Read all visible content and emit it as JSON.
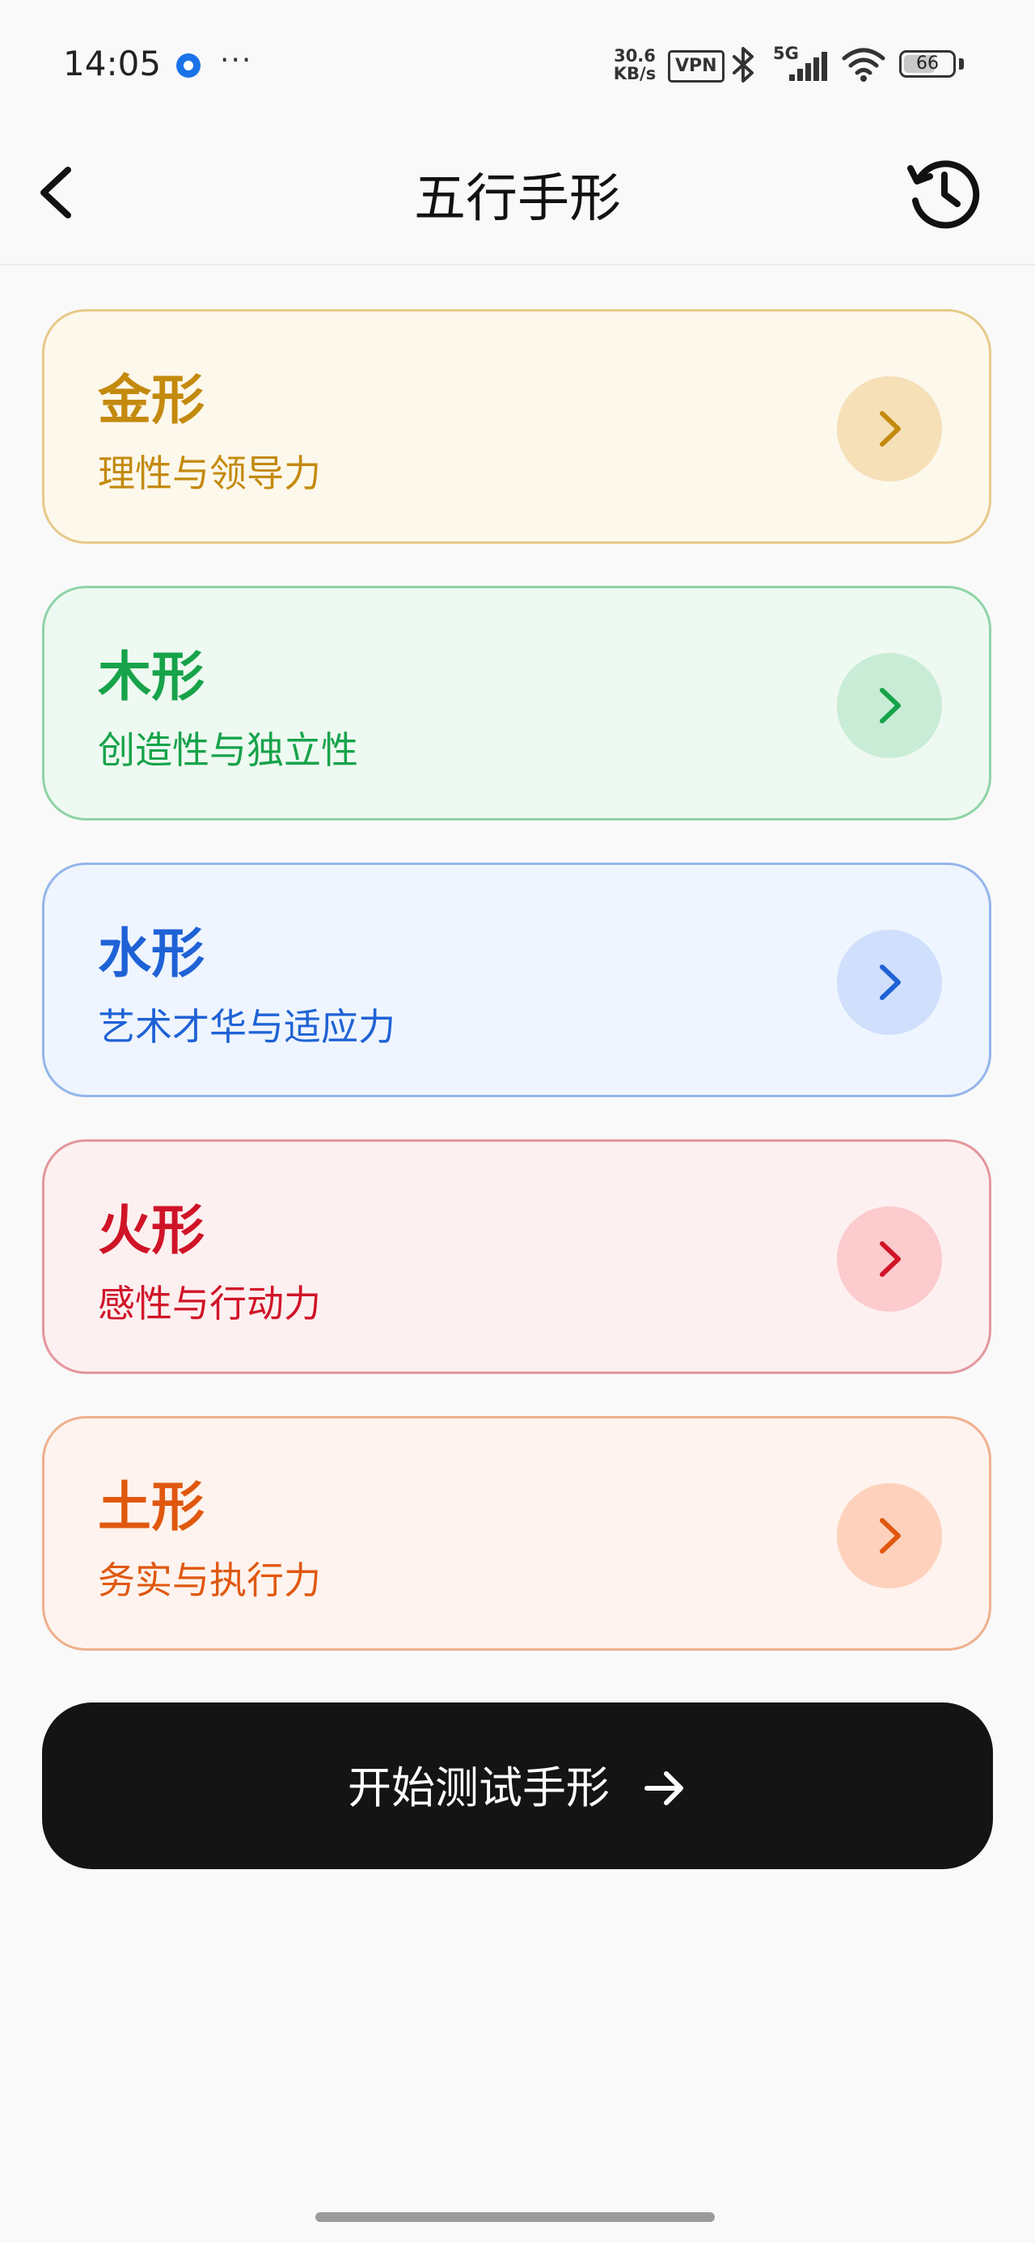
{
  "status_bar": {
    "time": "14:05",
    "more": "···",
    "speed_value": "30.6",
    "speed_unit": "KB/s",
    "vpn": "VPN",
    "network": "5G",
    "battery": "66",
    "battery_level_percent": 66
  },
  "header": {
    "title": "五行手形"
  },
  "cards": [
    {
      "title": "金形",
      "subtitle": "理性与领导力",
      "colors": {
        "text": "#c48a0e",
        "bg": "#fdf8ec",
        "border": "#e8c98a",
        "circle": "#f5e0b8",
        "chevron": "#c48a0e"
      }
    },
    {
      "title": "木形",
      "subtitle": "创造性与独立性",
      "colors": {
        "text": "#17a34a",
        "bg": "#eef9f1",
        "border": "#8fd4a6",
        "circle": "#c9ecd6",
        "chevron": "#17a34a"
      }
    },
    {
      "title": "水形",
      "subtitle": "艺术才华与适应力",
      "colors": {
        "text": "#1f62d6",
        "bg": "#eff5fe",
        "border": "#93b6ea",
        "circle": "#cfdffc",
        "chevron": "#1f62d6"
      }
    },
    {
      "title": "火形",
      "subtitle": "感性与行动力",
      "colors": {
        "text": "#d01428",
        "bg": "#fdf0f0",
        "border": "#e3979c",
        "circle": "#fccbcd",
        "chevron": "#d01428"
      }
    },
    {
      "title": "土形",
      "subtitle": "务实与执行力",
      "colors": {
        "text": "#e0580f",
        "bg": "#fef3ee",
        "border": "#efb08d",
        "circle": "#fdd1bc",
        "chevron": "#e0580f"
      }
    }
  ],
  "start_button": {
    "label": "开始测试手形"
  }
}
